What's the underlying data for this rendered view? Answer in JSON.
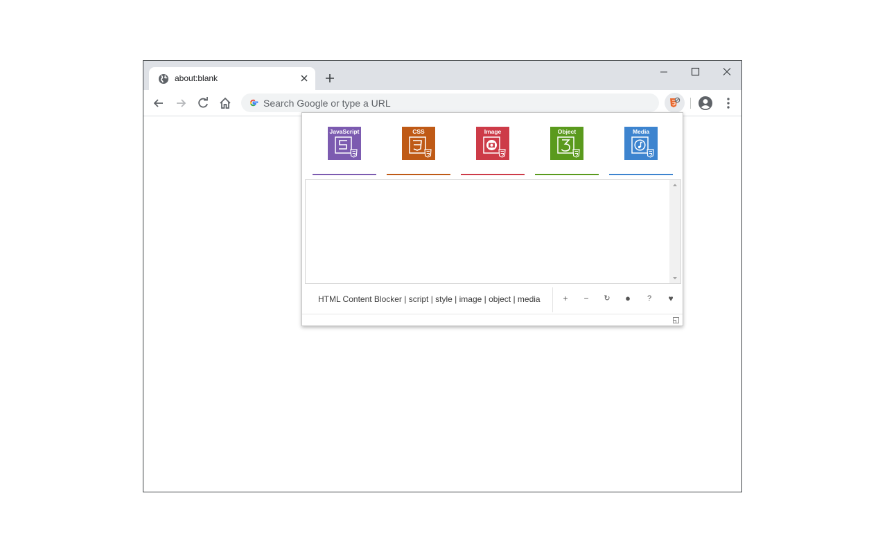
{
  "browser": {
    "tab": {
      "title": "about:blank"
    },
    "omnibox": {
      "placeholder": "Search Google or type a URL"
    }
  },
  "extension": {
    "categories": [
      {
        "label": "JavaScript",
        "glyph": "S",
        "color": "#7c5bb0"
      },
      {
        "label": "CSS",
        "glyph": "3",
        "color": "#bf5a16"
      },
      {
        "label": "Image",
        "glyph": "image",
        "color": "#cd3b48"
      },
      {
        "label": "Object",
        "glyph": "3",
        "color": "#5a9a1d"
      },
      {
        "label": "Media",
        "glyph": "music",
        "color": "#3d84cf"
      }
    ],
    "footer_text": "HTML Content Blocker | script | style | image | object | media",
    "buttons": [
      "+",
      "−",
      "↻",
      "●",
      "?",
      "♥"
    ]
  }
}
